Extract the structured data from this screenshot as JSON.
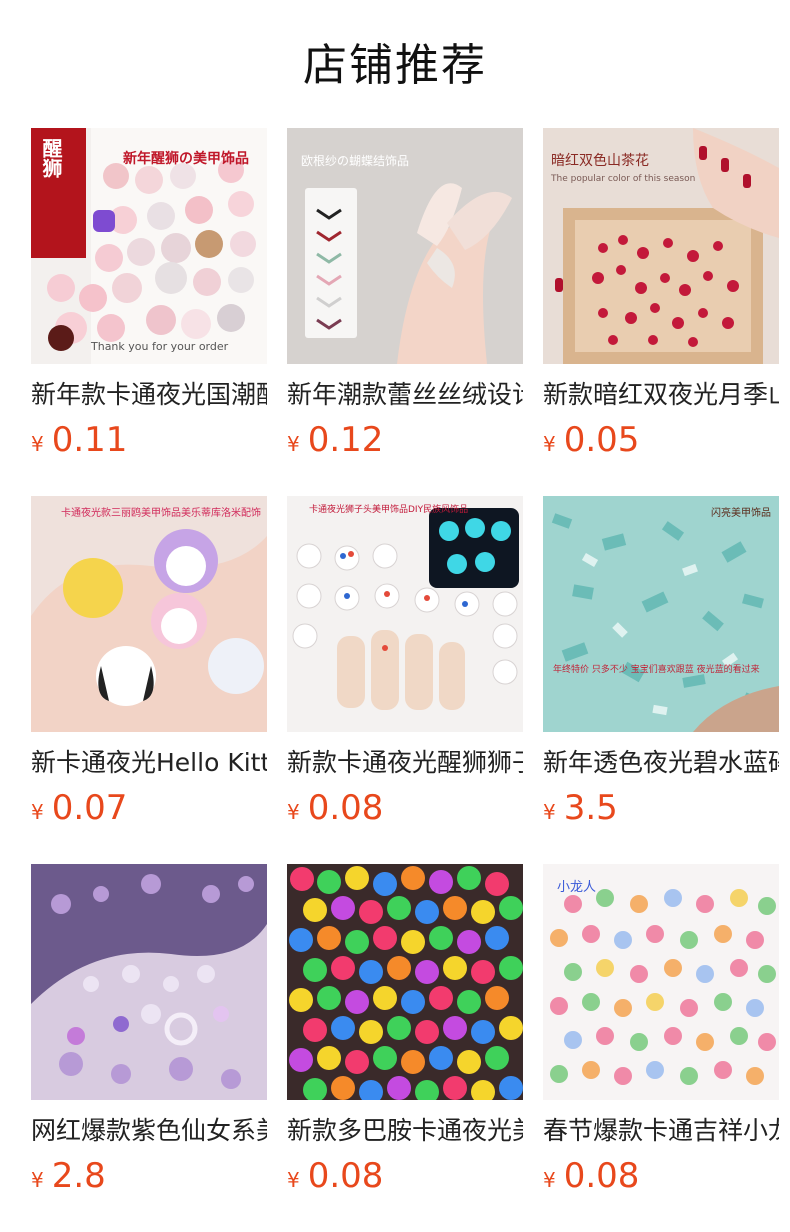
{
  "page": {
    "title": "店铺推荐"
  },
  "products": [
    {
      "name": "新年款卡通夜光国潮醒狮美甲饰品",
      "currency": "¥",
      "price": "0.11",
      "image_text": "新年醒狮の美甲饰品",
      "image_badge": "醒狮",
      "image_caption": "Thank you for your order"
    },
    {
      "name": "新年潮款蕾丝丝绒设计蝴蝶结饰品",
      "currency": "¥",
      "price": "0.12",
      "image_text": "欧根纱の蝴蝶结饰品"
    },
    {
      "name": "新款暗红双夜光月季山茶花饰品",
      "currency": "¥",
      "price": "0.05",
      "image_text": "暗红双色山茶花",
      "image_caption": "The popular color of this season"
    },
    {
      "name": "新卡通夜光Hello Kitty美甲饰品",
      "currency": "¥",
      "price": "0.07",
      "image_text": "卡通夜光款三丽鸥美甲饰品美乐蒂库洛米配饰"
    },
    {
      "name": "新款卡通夜光醒狮狮子头美甲饰品",
      "currency": "¥",
      "price": "0.08",
      "image_text": "卡通夜光狮子头美甲饰品DIY民族风饰品"
    },
    {
      "name": "新年透色夜光碧水蓝碎钻饰品",
      "currency": "¥",
      "price": "3.5",
      "image_text": "闪亮美甲饰品",
      "image_caption": "年终特价 只多不少 宝宝们喜欢跟蓝 夜光蓝的看过来"
    },
    {
      "name": "网红爆款紫色仙女系美甲饰品",
      "currency": "¥",
      "price": "2.8"
    },
    {
      "name": "新款多巴胺卡通夜光美甲饰品",
      "currency": "¥",
      "price": "0.08"
    },
    {
      "name": "春节爆款卡通吉祥小龙美甲饰品",
      "currency": "¥",
      "price": "0.08",
      "image_text": "小龙人"
    }
  ],
  "colors": {
    "price": "#e8481c",
    "title": "#111111"
  }
}
